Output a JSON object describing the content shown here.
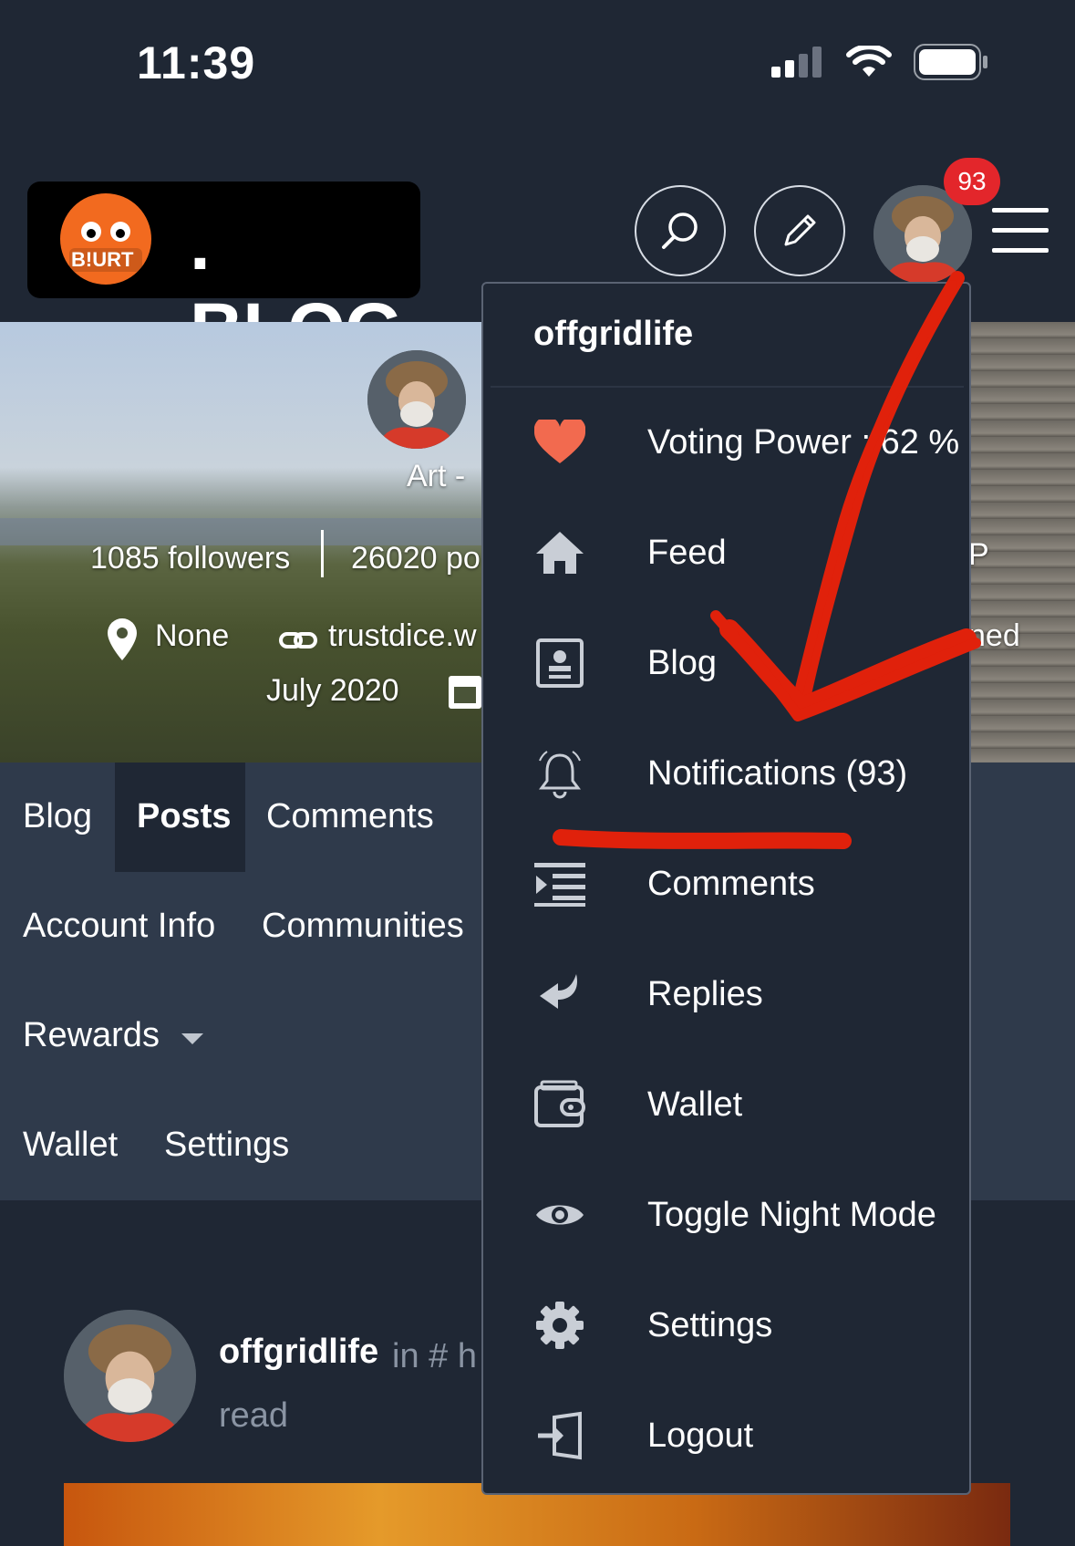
{
  "status_bar": {
    "time": "11:39"
  },
  "header": {
    "logo_text": ". BLOG",
    "logo_badge": "B!URT",
    "notification_count": "93",
    "accent": "#f26a1f",
    "badge_color": "#e3262b",
    "icons": [
      "search-icon",
      "pencil-icon",
      "hamburger-icon"
    ]
  },
  "profile": {
    "name_partial": "Art - ",
    "followers": "1085 followers",
    "posts_partial": "26020 po",
    "location": "None",
    "website_partial": "trustdice.w",
    "joined_date": "July 2020",
    "joined_partial": "ned",
    "right_partial": "P"
  },
  "tabs": {
    "row1": [
      "Blog",
      "Posts",
      "Comments"
    ],
    "active": "Posts",
    "row2": [
      "Account Info",
      "Communities"
    ],
    "rewards": "Rewards",
    "row4": [
      "Wallet",
      "Settings"
    ]
  },
  "feed_post": {
    "author": "offgridlife",
    "community_partial": "in # h",
    "read": "read"
  },
  "dropdown": {
    "username": "offgridlife",
    "items": [
      {
        "label": "Voting Power : 62 %",
        "icon": "heart-icon"
      },
      {
        "label": "Feed",
        "icon": "home-icon"
      },
      {
        "label": "Blog",
        "icon": "blog-icon"
      },
      {
        "label": "Notifications (93)",
        "icon": "bell-icon"
      },
      {
        "label": "Comments",
        "icon": "comments-list-icon"
      },
      {
        "label": "Replies",
        "icon": "reply-icon"
      },
      {
        "label": "Wallet",
        "icon": "wallet-icon"
      },
      {
        "label": "Toggle Night Mode",
        "icon": "eye-icon"
      },
      {
        "label": "Settings",
        "icon": "gear-icon"
      },
      {
        "label": "Logout",
        "icon": "logout-icon"
      }
    ],
    "heart_color": "#f26a4f",
    "annotation_color": "#e0210b"
  }
}
